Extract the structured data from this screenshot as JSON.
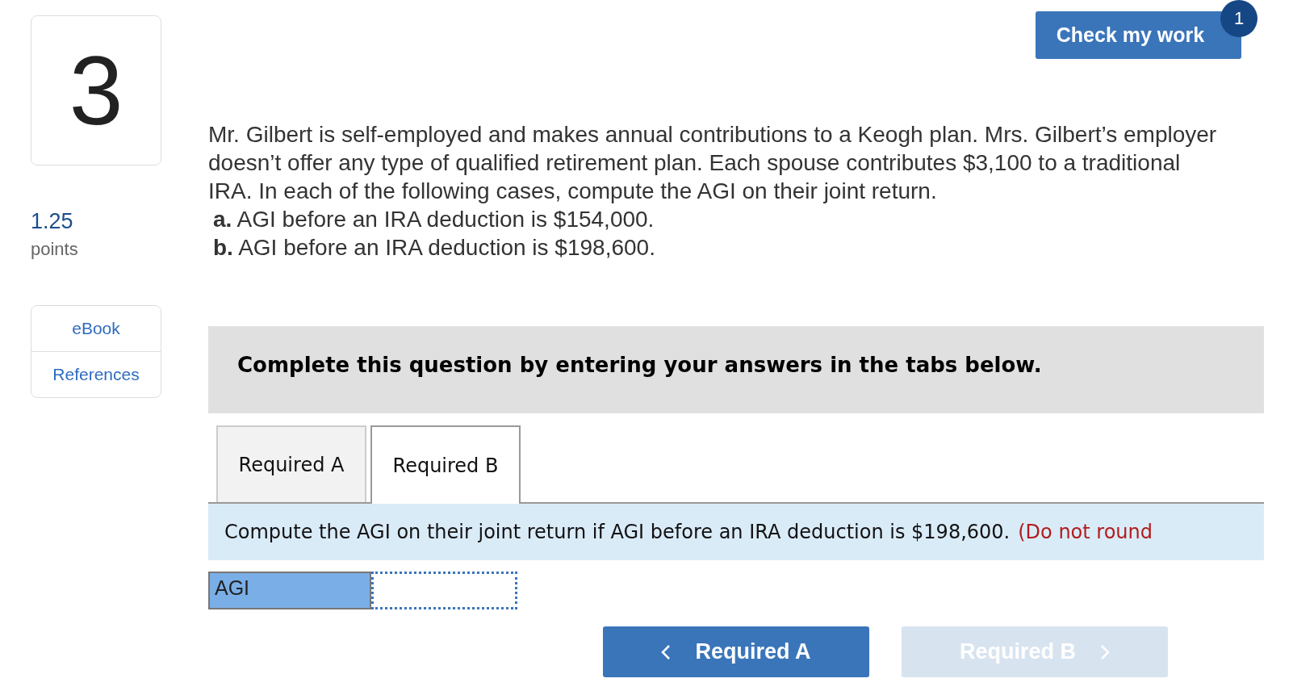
{
  "question_number": "3",
  "points": {
    "value": "1.25",
    "label": "points"
  },
  "side_links": [
    {
      "label": "eBook"
    },
    {
      "label": "References"
    }
  ],
  "check_button": {
    "label": "Check my work",
    "badge": "1"
  },
  "question": {
    "text": "Mr. Gilbert is self-employed and makes annual contributions to a Keogh plan. Mrs. Gilbert’s employer doesn’t offer any type of qualified retirement plan. Each spouse contributes $3,100 to a traditional IRA. In each of the following cases, compute the AGI on their joint return.",
    "parts": [
      "**a.** AGI before an IRA deduction is $154,000.",
      "**b.** AGI before an IRA deduction is $198,600."
    ]
  },
  "instructions": "Complete this question by entering your answers in the tabs below.",
  "tabs": [
    {
      "label": "Required A",
      "selected": false
    },
    {
      "label": "Required B",
      "selected": true
    }
  ],
  "prompt": {
    "text": "Compute the AGI on their joint return if AGI before an IRA deduction is $198,600.",
    "note": "(Do not round"
  },
  "answer_row": {
    "label": "AGI"
  },
  "nav_buttons": [
    {
      "label": "Required A",
      "kind": "prev",
      "disabled": false
    },
    {
      "label": "Required B",
      "kind": "next",
      "disabled": true
    }
  ]
}
